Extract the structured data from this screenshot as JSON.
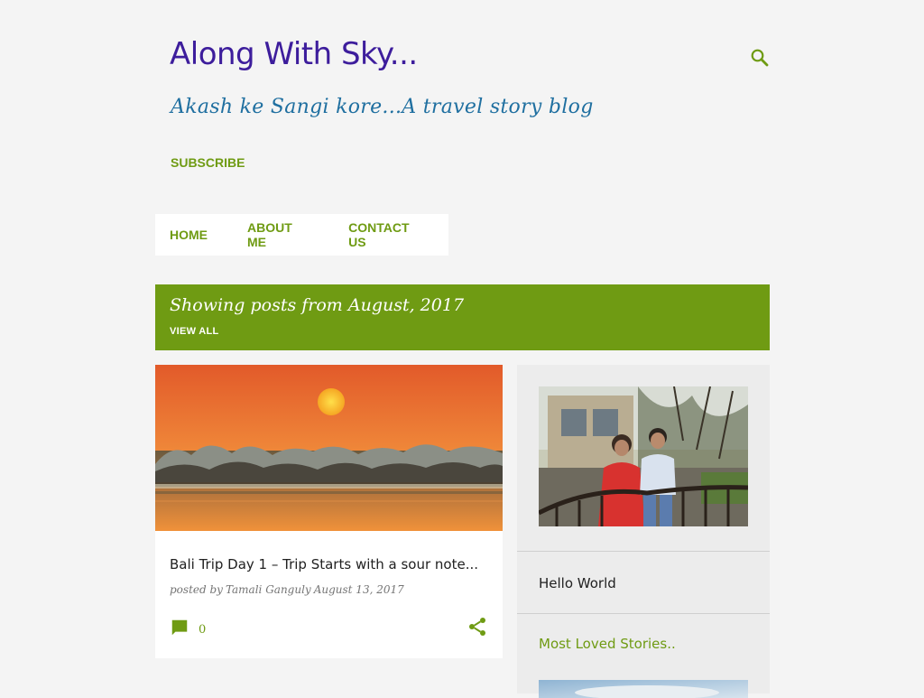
{
  "header": {
    "title": "Along With Sky...",
    "description": "Akash ke Sangi kore...A travel story blog",
    "subscribe_label": "SUBSCRIBE",
    "search_icon": "search-icon"
  },
  "nav": {
    "items": [
      {
        "label": "HOME"
      },
      {
        "label": "ABOUT ME"
      },
      {
        "label": "CONTACT US"
      }
    ]
  },
  "archive": {
    "title": "Showing posts from August, 2017",
    "view_all_label": "VIEW ALL"
  },
  "post": {
    "title": "Bali Trip Day 1 – Trip Starts with a sour note...",
    "posted_by_label": "posted by",
    "author": "Tamali Ganguly",
    "date": "August 13, 2017",
    "comment_count": "0",
    "comment_icon": "comment-icon",
    "share_icon": "share-icon"
  },
  "sidebar": {
    "profile_name": "Hello World",
    "popular_title": "Most Loved Stories.."
  },
  "colors": {
    "accent": "#6f9b13",
    "title": "#3d1d9c",
    "description": "#1f6fa0",
    "background": "#f4f4f4"
  }
}
